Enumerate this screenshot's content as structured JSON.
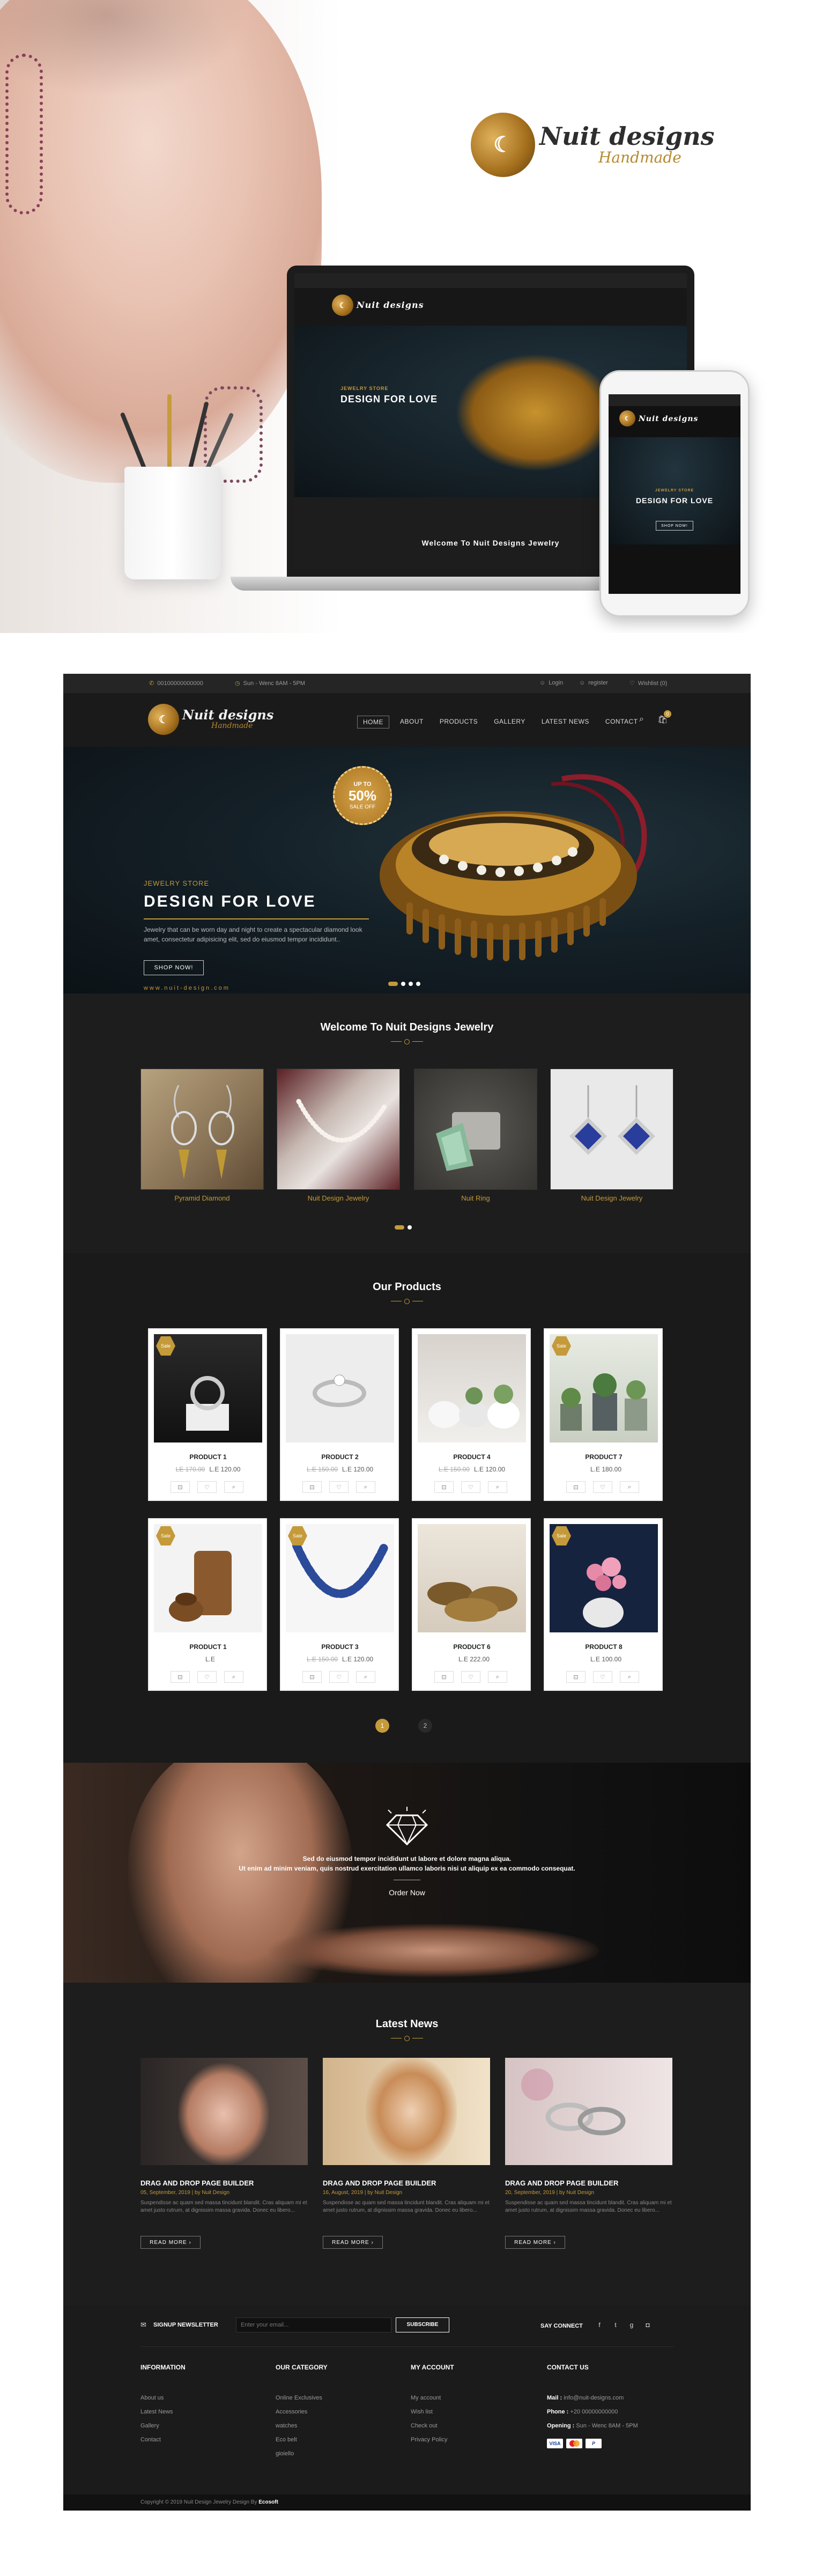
{
  "mockup": {
    "brand": "Nuit designs",
    "tagline": "Handmade",
    "mini_banner_kicker": "JEWELRY STORE",
    "mini_banner_title": "DESIGN FOR LOVE",
    "mini_footer": "Welcome To Nuit Designs Jewelry",
    "mini_button": "SHOP NOW!"
  },
  "topbar": {
    "phone": "00100000000000",
    "hours": "Sun - Wenc 8AM - 5PM",
    "login": "Login",
    "register": "register",
    "wishlist": "Wishlist (0)"
  },
  "nav": {
    "brand": "Nuit designs",
    "tagline": "Handmade",
    "items": [
      "HOME",
      "ABOUT",
      "PRODUCTS",
      "GALLERY",
      "LATEST NEWS",
      "CONTACT"
    ],
    "cart_count": "0"
  },
  "banner": {
    "badge_top": "UP TO",
    "badge_value": "50%",
    "badge_bottom": "SALE OFF",
    "kicker": "JEWELRY STORE",
    "title": "DESIGN FOR LOVE",
    "text": "Jewelry that can be worn day and night to create a spectacular diamond look amet, consectetur adipisicing elit, sed do eiusmod tempor incididunt..",
    "button": "SHOP NOW!",
    "url": "www.nuit-design.com"
  },
  "welcome": {
    "title": "Welcome To Nuit Designs Jewelry",
    "categories": [
      "Pyramid Diamond",
      "Nuit Design Jewelry",
      "Nuit Ring",
      "Nuit Design Jewelry"
    ]
  },
  "products": {
    "title": "Our Products",
    "items": [
      {
        "name": "PRODUCT 1",
        "old": "LE 170.00",
        "price": "L.E 120.00",
        "tag": "Sale"
      },
      {
        "name": "PRODUCT 2",
        "old": "L.E 150.00",
        "price": "L.E 120.00",
        "tag": ""
      },
      {
        "name": "PRODUCT 4",
        "old": "L.E 150.00",
        "price": "L.E 120.00",
        "tag": ""
      },
      {
        "name": "PRODUCT 7",
        "old": "",
        "price": "L.E 180.00",
        "tag": "Sale"
      },
      {
        "name": "PRODUCT 1",
        "old": "",
        "price": "L.E",
        "tag": "Sale"
      },
      {
        "name": "PRODUCT 3",
        "old": "L.E 150.00",
        "price": "L.E 120.00",
        "tag": "Sale"
      },
      {
        "name": "PRODUCT 6",
        "old": "",
        "price": "L.E 222.00",
        "tag": ""
      },
      {
        "name": "PRODUCT 8",
        "old": "",
        "price": "L.E 100.00",
        "tag": "Sale"
      }
    ],
    "pages": [
      "1",
      "2"
    ]
  },
  "promo": {
    "line1": "Sed do eiusmod tempor incididunt ut labore et dolore magna aliqua.",
    "line2": "Ut enim ad minim veniam, quis nostrud exercitation ullamco laboris nisi ut aliquip ex ea commodo consequat.",
    "button": "Order Now"
  },
  "news": {
    "title": "Latest News",
    "items": [
      {
        "title": "DRAG AND DROP PAGE BUILDER",
        "meta": "05, September, 2019  |  by Nuit Design",
        "text": "Suspendisse ac quam sed massa tincidunt blandit. Cras aliquam mi et amet justo rutrum, at dignissim massa gravida. Donec eu libero...",
        "button": "READ MORE"
      },
      {
        "title": "DRAG AND DROP PAGE BUILDER",
        "meta": "16, August, 2019  |  by Nuit Design",
        "text": "Suspendisse ac quam sed massa tincidunt blandit. Cras aliquam mi et amet justo rutrum, at dignissim massa gravida. Donec eu libero...",
        "button": "READ MORE"
      },
      {
        "title": "DRAG AND DROP PAGE BUILDER",
        "meta": "20, September, 2019  |  by Nuit Design",
        "text": "Suspendisse ac quam sed massa tincidunt blandit. Cras aliquam mi et amet justo rutrum, at dignissim massa gravida. Donec eu libero...",
        "button": "READ MORE"
      }
    ]
  },
  "footer": {
    "newsletter_label": "SIGNUP NEWSLETTER",
    "email_placeholder": "Enter your email...",
    "subscribe": "SUBSCRIBE",
    "say_connect": "SAY CONNECT",
    "information_title": "INFORMATION",
    "information": [
      "About us",
      "Latest News",
      "Gallery",
      "Contact"
    ],
    "category_title": "OUR CATEGORY",
    "category": [
      "Online Exclusives",
      "Accessories",
      "watches",
      "Eco belt",
      "gioiello"
    ],
    "account_title": "MY ACCOUNT",
    "account": [
      "My account",
      "Wish list",
      "Check out",
      "Privacy Policy"
    ],
    "contact_title": "CONTACT US",
    "mail_label": "Mail :",
    "mail": "info@nuit-designs.com",
    "phone_label": "Phone :",
    "phone": "+20 00000000000",
    "opening_label": "Opening :",
    "opening": "Sun - Wenc 8AM - 5PM",
    "copyright": "Copyright © 2019 Nuit Design Jewelry Design By",
    "copyright_brand": "Ecosoft"
  },
  "colors": {
    "accent": "#c49a3a",
    "dark": "#1d1d1d"
  }
}
